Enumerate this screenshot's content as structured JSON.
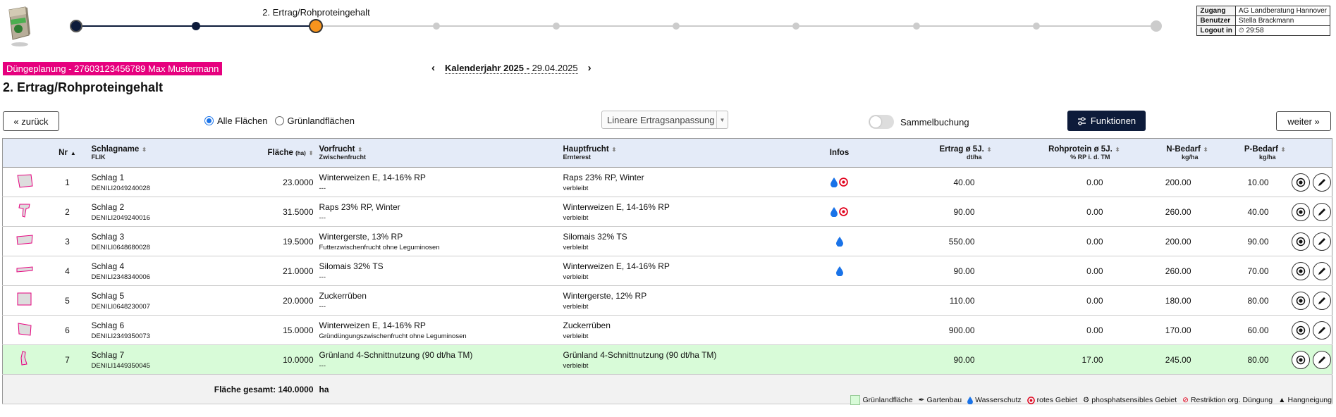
{
  "stepper": {
    "current_label": "2. Ertrag/Rohproteingehalt",
    "total_steps": 10,
    "current_step": 3,
    "colors": {
      "done": "#0d1b3a",
      "current": "#f7941d",
      "pending": "#cccccc"
    }
  },
  "login_box": {
    "rows": [
      {
        "key": "Zugang",
        "value": "AG Landberatung Hannover"
      },
      {
        "key": "Benutzer",
        "value": "Stella Brackmann"
      },
      {
        "key": "Logout in",
        "value": "29:58"
      }
    ]
  },
  "plan_tag": "Düngeplanung - 27603123456789 Max Mustermann",
  "page_title": "2. Ertrag/Rohproteingehalt",
  "year_nav": {
    "year": "Kalenderjahr 2025 -",
    "date": "29.04.2025"
  },
  "toolbar": {
    "back_label": "« zurück",
    "next_label": "weiter »",
    "radio_all": "Alle Flächen",
    "radio_grass": "Grünlandflächen",
    "adjust_select": "Lineare Ertragsanpassung",
    "collect_label": "Sammelbuchung",
    "functions_label": "Funktionen"
  },
  "table": {
    "headers": {
      "nr": "Nr",
      "name": "Schlagname",
      "name_sub": "FLIK",
      "area": "Fläche",
      "area_unit": "(ha)",
      "prev": "Vorfrucht",
      "prev_sub": "Zwischenfrucht",
      "main": "Hauptfrucht",
      "main_sub": "Ernterest",
      "infos": "Infos",
      "yield": "Ertrag ø 5J.",
      "yield_sub": "dt/ha",
      "protein": "Rohprotein ø 5J.",
      "protein_sub": "% RP i. d. TM",
      "n": "N-Bedarf",
      "n_sub": "kg/ha",
      "p": "P-Bedarf",
      "p_sub": "kg/ha"
    },
    "rows": [
      {
        "nr": "1",
        "name": "Schlag 1",
        "flik": "DENILI2049240028",
        "area": "23.0000",
        "prev": "Winterweizen E, 14-16% RP",
        "catch": "---",
        "main": "Raps 23% RP, Winter",
        "residue": "verbleibt",
        "yield": "40.00",
        "protein": "0.00",
        "n": "200.00",
        "p": "10.00",
        "water": true,
        "red": true,
        "grass": false
      },
      {
        "nr": "2",
        "name": "Schlag 2",
        "flik": "DENILI2049240016",
        "area": "31.5000",
        "prev": "Raps 23% RP, Winter",
        "catch": "---",
        "main": "Winterweizen E, 14-16% RP",
        "residue": "verbleibt",
        "yield": "90.00",
        "protein": "0.00",
        "n": "260.00",
        "p": "40.00",
        "water": true,
        "red": true,
        "grass": false
      },
      {
        "nr": "3",
        "name": "Schlag 3",
        "flik": "DENILI0648680028",
        "area": "19.5000",
        "prev": "Wintergerste, 13% RP",
        "catch": "Futterzwischenfrucht ohne Leguminosen",
        "main": "Silomais 32% TS",
        "residue": "verbleibt",
        "yield": "550.00",
        "protein": "0.00",
        "n": "200.00",
        "p": "90.00",
        "water": true,
        "red": false,
        "grass": false
      },
      {
        "nr": "4",
        "name": "Schlag 4",
        "flik": "DENILI2348340006",
        "area": "21.0000",
        "prev": "Silomais 32% TS",
        "catch": "---",
        "main": "Winterweizen E, 14-16% RP",
        "residue": "verbleibt",
        "yield": "90.00",
        "protein": "0.00",
        "n": "260.00",
        "p": "70.00",
        "water": true,
        "red": false,
        "grass": false
      },
      {
        "nr": "5",
        "name": "Schlag 5",
        "flik": "DENILI0648230007",
        "area": "20.0000",
        "prev": "Zuckerrüben",
        "catch": "---",
        "main": "Wintergerste, 12% RP",
        "residue": "verbleibt",
        "yield": "110.00",
        "protein": "0.00",
        "n": "180.00",
        "p": "80.00",
        "water": false,
        "red": false,
        "grass": false
      },
      {
        "nr": "6",
        "name": "Schlag 6",
        "flik": "DENILI2349350073",
        "area": "15.0000",
        "prev": "Winterweizen E, 14-16% RP",
        "catch": "Gründüngungszwischenfrucht ohne Leguminosen",
        "main": "Zuckerrüben",
        "residue": "verbleibt",
        "yield": "900.00",
        "protein": "0.00",
        "n": "170.00",
        "p": "60.00",
        "water": false,
        "red": false,
        "grass": false
      },
      {
        "nr": "7",
        "name": "Schlag 7",
        "flik": "DENILI1449350045",
        "area": "10.0000",
        "prev": "Grünland 4-Schnittnutzung (90 dt/ha TM)",
        "catch": "---",
        "main": "Grünland 4-Schnittnutzung (90 dt/ha TM)",
        "residue": "verbleibt",
        "yield": "90.00",
        "protein": "17.00",
        "n": "245.00",
        "p": "80.00",
        "water": false,
        "red": false,
        "grass": true
      }
    ],
    "total_label": "Fläche gesamt: 140.0000",
    "total_unit": "ha"
  },
  "legend": {
    "grass": "Grünlandfläche",
    "garden": "Gartenbau",
    "water": "Wasserschutz",
    "red": "rotes Gebiet",
    "phosphate": "phosphatsensibles Gebiet",
    "restriction": "Restriktion org. Düngung",
    "slope": "Hangneigung"
  },
  "icons": {
    "water": "water-drop-icon",
    "red": "red-area-icon",
    "view": "view-icon",
    "edit": "pencil-icon"
  },
  "colors": {
    "accent": "#e6007e",
    "header_bg": "#e4ebf8",
    "grass_row": "#d8fbd8",
    "button_dark": "#0d1b3a"
  }
}
